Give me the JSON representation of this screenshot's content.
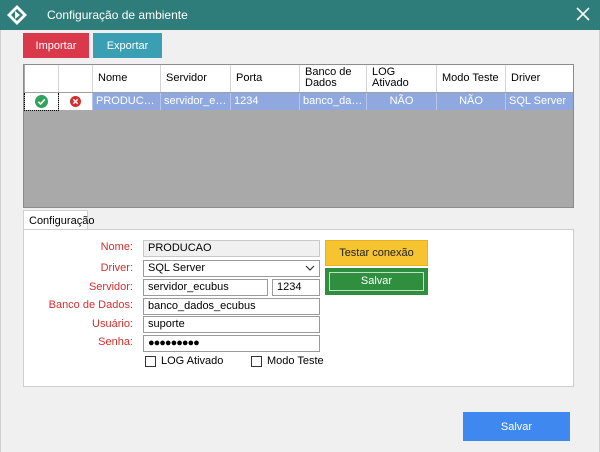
{
  "window": {
    "title": "Configuração de ambiente"
  },
  "toolbar": {
    "import_label": "Importar",
    "export_label": "Exportar"
  },
  "grid": {
    "columns": [
      "",
      "",
      "Nome",
      "Servidor",
      "Porta",
      "Banco de Dados",
      "LOG Ativado",
      "Modo Teste",
      "Driver"
    ],
    "rows": [
      {
        "active_icon": "check-circle-icon",
        "delete_icon": "remove-circle-icon",
        "nome": "PRODUCAO",
        "servidor": "servidor_ecubus",
        "porta": "1234",
        "banco": "banco_dados_ecubus",
        "log": "NÃO",
        "modo_teste": "NÃO",
        "driver": "SQL Server"
      }
    ]
  },
  "tab": {
    "label": "Configuração"
  },
  "form": {
    "nome_label": "Nome:",
    "nome_value": "PRODUCAO",
    "driver_label": "Driver:",
    "driver_value": "SQL Server",
    "servidor_label": "Servidor:",
    "servidor_value": "servidor_ecubus",
    "porta_value": "1234",
    "banco_label": "Banco de Dados:",
    "banco_value": "banco_dados_ecubus",
    "usuario_label": "Usuário:",
    "usuario_value": "suporte",
    "senha_label": "Senha:",
    "senha_value": "●●●●●●●●●",
    "log_label": "LOG Ativado",
    "log_checked": false,
    "modo_teste_label": "Modo Teste",
    "modo_teste_checked": false,
    "test_button": "Testar conexão",
    "save_button": "Salvar"
  },
  "footer": {
    "save_button": "Salvar"
  },
  "colors": {
    "titlebar": "#2e7d7a",
    "import": "#d9394a",
    "export": "#3a9fb2",
    "selected_row": "#8fa9e0",
    "test": "#f6c431",
    "save_green": "#2f8f3e",
    "save_main": "#3f88f0",
    "label_red": "#d32f2f"
  }
}
